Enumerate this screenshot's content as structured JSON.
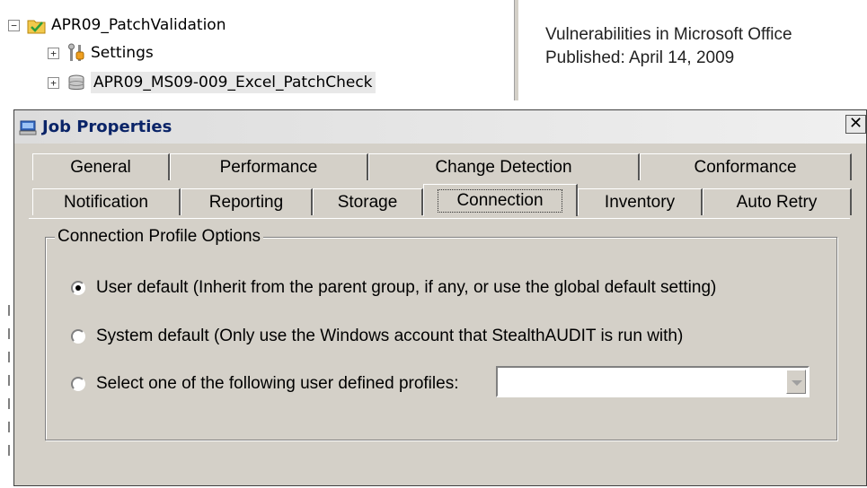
{
  "tree": {
    "root": {
      "label": "APR09_PatchValidation",
      "expander": "−",
      "icon": "folder-check-icon"
    },
    "children": [
      {
        "label": "Settings",
        "expander": "+",
        "icon": "settings-tools-icon"
      },
      {
        "label": "APR09_MS09-009_Excel_PatchCheck",
        "expander": "+",
        "icon": "database-icon"
      }
    ]
  },
  "info": {
    "line1": "Vulnerabilities in Microsoft Office",
    "line2": "Published: April 14, 2009"
  },
  "dialog": {
    "title": "Job Properties",
    "close_label": "✕",
    "tabs_row1": [
      "General",
      "Performance",
      "Change Detection",
      "Conformance"
    ],
    "tabs_row2": [
      "Notification",
      "Reporting",
      "Storage",
      "Connection",
      "Inventory",
      "Auto Retry"
    ],
    "active_tab": "Connection",
    "group": {
      "legend": "Connection Profile Options",
      "options": [
        {
          "label": "User default (Inherit from the parent group, if any, or use the global default setting)",
          "checked": true
        },
        {
          "label": "System default (Only use the Windows account that StealthAUDIT is run with)",
          "checked": false
        },
        {
          "label": "Select one of the following user defined profiles:",
          "checked": false
        }
      ],
      "profile_select_value": ""
    }
  }
}
